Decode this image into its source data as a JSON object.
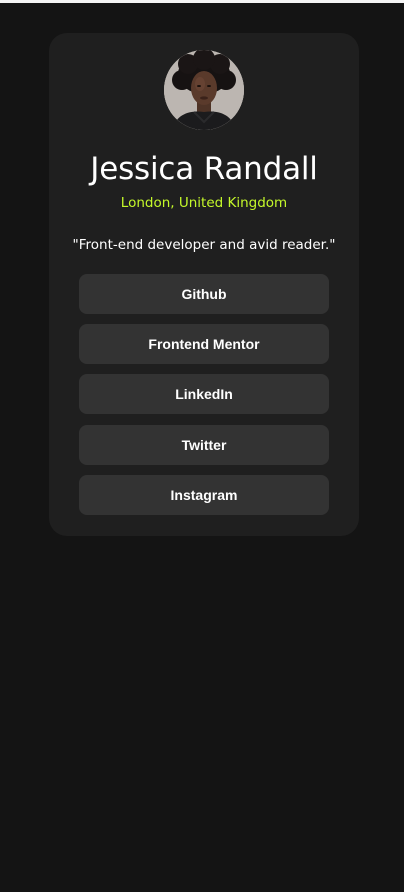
{
  "profile": {
    "name": "Jessica Randall",
    "location": "London, United Kingdom",
    "bio": "\"Front-end developer and avid reader.\""
  },
  "links": [
    {
      "label": "Github"
    },
    {
      "label": "Frontend Mentor"
    },
    {
      "label": "LinkedIn"
    },
    {
      "label": "Twitter"
    },
    {
      "label": "Instagram"
    }
  ],
  "colors": {
    "page_background": "#141414",
    "card_background": "#1f1f1f",
    "button_background": "#333333",
    "accent": "#c4f82a",
    "text": "#ffffff"
  }
}
